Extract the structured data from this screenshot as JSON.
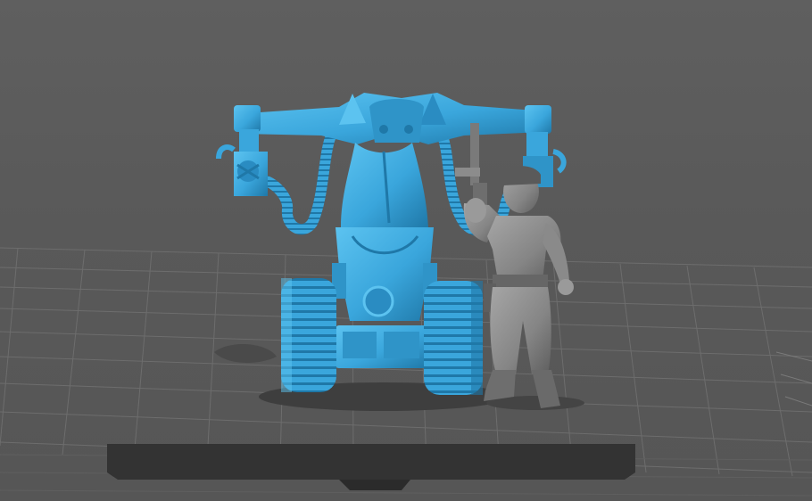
{
  "scene": {
    "models": [
      {
        "name": "tracked-robot",
        "color": "#3aa6dc"
      },
      {
        "name": "soldier-figure",
        "color": "#8c8c8c"
      }
    ],
    "background_color": "#5a5a5a",
    "grid_color": "#6b6b6b",
    "base_plate_color": "#333333"
  }
}
